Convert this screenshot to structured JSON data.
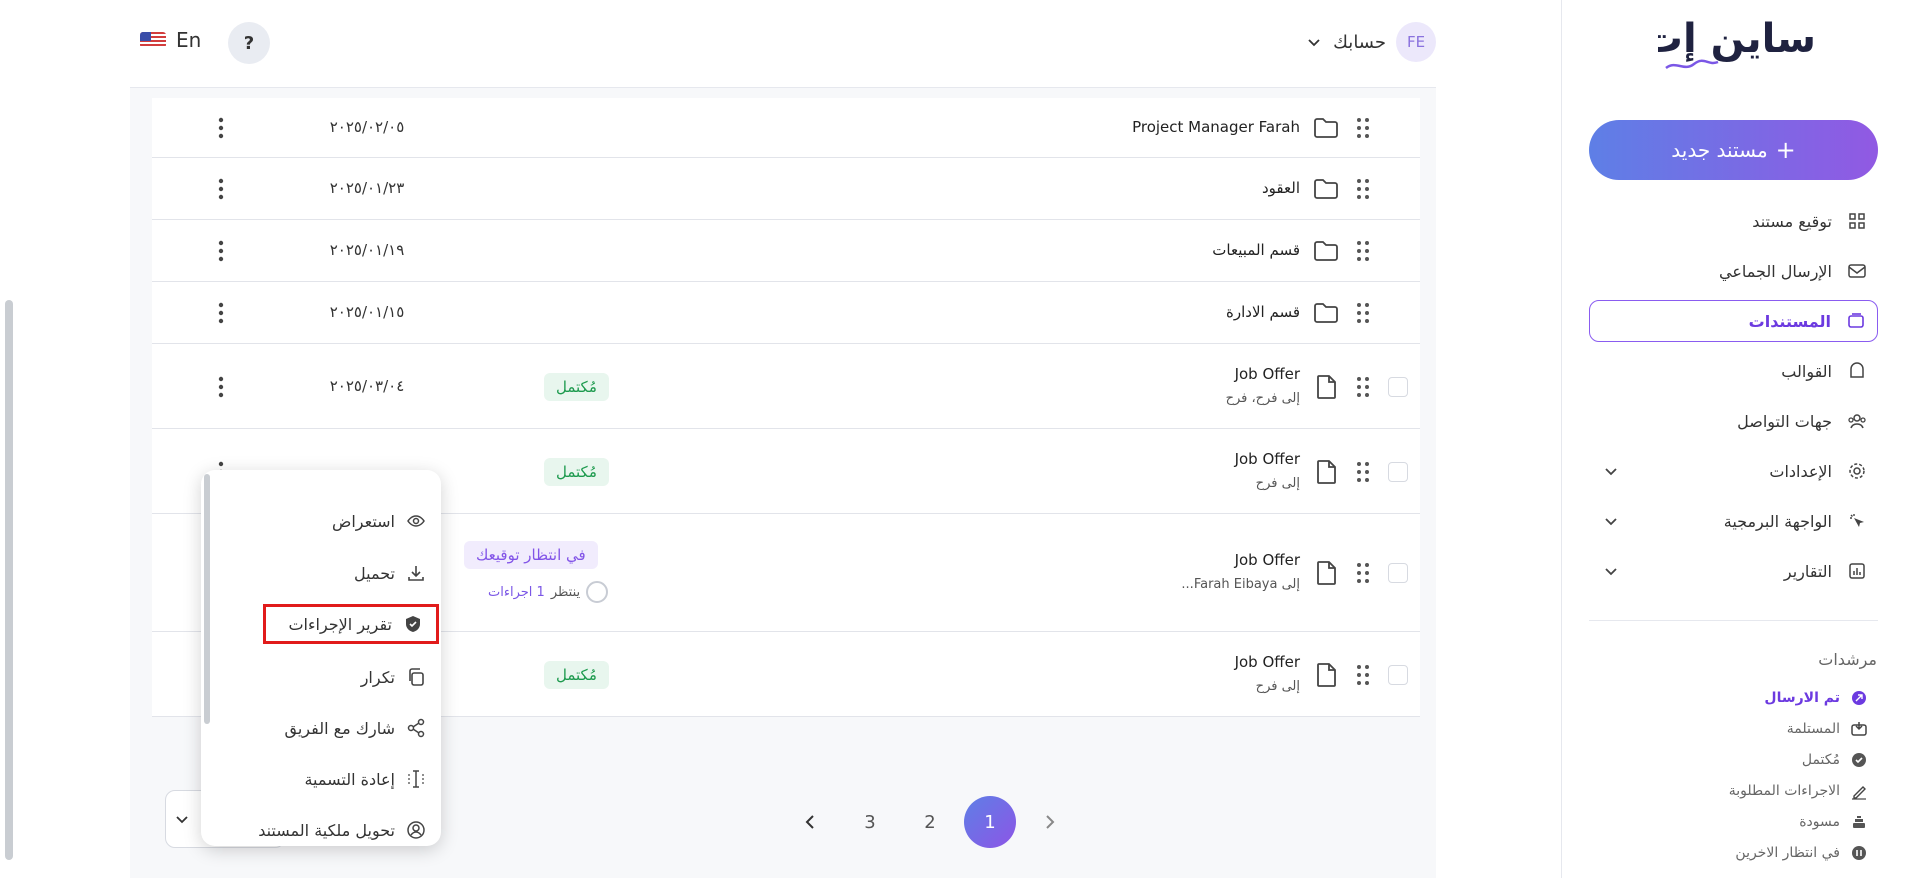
{
  "brand": {
    "logo_text": "ساين إت"
  },
  "sidebar": {
    "new_document": "مستند جديد",
    "items": [
      {
        "label": "توقيع مستند",
        "icon": "grid-icon"
      },
      {
        "label": "الإرسال الجماعي",
        "icon": "bulk-mail-icon"
      },
      {
        "label": "المستندات",
        "icon": "documents-icon",
        "active": true
      },
      {
        "label": "القوالب",
        "icon": "templates-icon"
      },
      {
        "label": "جهات التواصل",
        "icon": "contacts-icon"
      },
      {
        "label": "الإعدادات",
        "icon": "gear-icon",
        "expandable": true
      },
      {
        "label": "الواجهة البرمجية",
        "icon": "api-icon",
        "expandable": true
      },
      {
        "label": "التقارير",
        "icon": "reports-icon",
        "expandable": true
      }
    ],
    "filters_title": "مرشدات",
    "filters": [
      {
        "label": "تم الارسال",
        "icon": "sent-icon",
        "active": true
      },
      {
        "label": "المستلمة",
        "icon": "inbox-icon"
      },
      {
        "label": "مُكتمل",
        "icon": "check-circle-icon"
      },
      {
        "label": "الاجراءات المطلوبة",
        "icon": "sign-pen-icon"
      },
      {
        "label": "مسودة",
        "icon": "draft-icon"
      },
      {
        "label": "في انتظار الاخرين",
        "icon": "pause-icon"
      }
    ]
  },
  "topbar": {
    "language": "En",
    "help": "?",
    "account_label": "حسابك",
    "avatar_initials": "FE"
  },
  "table": {
    "rows": [
      {
        "type": "folder",
        "name": "Project Manager Farah",
        "date": "٢٠٢٥/٠٢/٠٥"
      },
      {
        "type": "folder",
        "name": "العقود",
        "date": "٢٠٢٥/٠١/٢٣"
      },
      {
        "type": "folder",
        "name": "قسم المبيعات",
        "date": "٢٠٢٥/٠١/١٩"
      },
      {
        "type": "folder",
        "name": "قسم الادارة",
        "date": "٢٠٢٥/٠١/١٥"
      },
      {
        "type": "document",
        "name": "Job Offer",
        "recipients": "إلى فرح، فرح",
        "date": "٢٠٢٥/٠٣/٠٤",
        "status": "مُكتمل"
      },
      {
        "type": "document",
        "name": "Job Offer",
        "recipients": "إلى فرح",
        "status": "مُكتمل"
      },
      {
        "type": "document",
        "name": "Job Offer",
        "recipients": "إلى Farah Eibaya...",
        "status": "في انتظار توقيعك",
        "pending_label": "ينتظر",
        "pending_actions": "1 اجراءات"
      },
      {
        "type": "document",
        "name": "Job Offer",
        "recipients": "إلى فرح",
        "status": "مُكتمل"
      }
    ]
  },
  "pagination": {
    "pages": [
      "3",
      "2",
      "1"
    ],
    "current": "1"
  },
  "context_menu": {
    "items": [
      {
        "label": "استعراض",
        "icon": "eye-icon"
      },
      {
        "label": "تحميل",
        "icon": "download-icon"
      },
      {
        "label": "تقرير الإجراءات",
        "icon": "shield-check-icon",
        "highlighted": true
      },
      {
        "label": "تكرار",
        "icon": "copy-icon"
      },
      {
        "label": "شارك مع الفريق",
        "icon": "share-icon"
      },
      {
        "label": "إعادة التسمية",
        "icon": "rename-icon"
      },
      {
        "label": "تحويل ملكية المستند",
        "icon": "user-circle-icon"
      }
    ]
  },
  "colors": {
    "accent": "#7b57e6",
    "success": "#1d9a4e",
    "highlight_box": "#e11b1b"
  }
}
